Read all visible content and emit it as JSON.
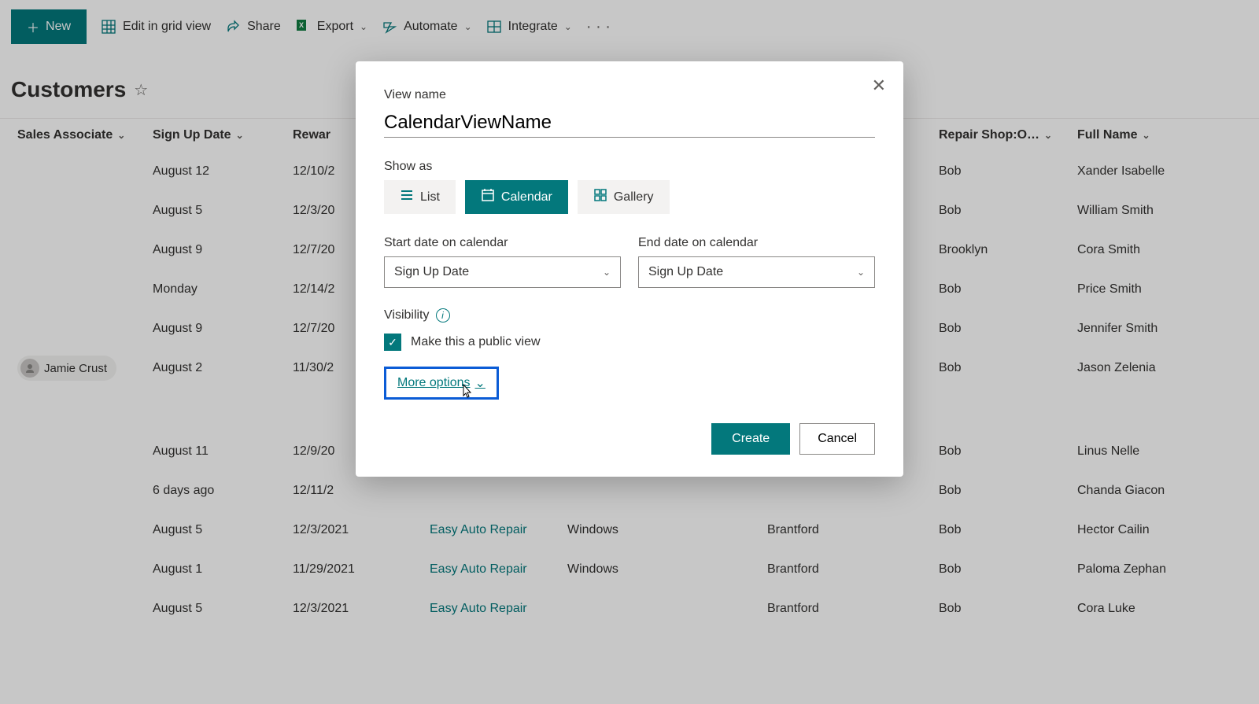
{
  "toolbar": {
    "new_label": "New",
    "edit_grid_label": "Edit in grid view",
    "share_label": "Share",
    "export_label": "Export",
    "automate_label": "Automate",
    "integrate_label": "Integrate"
  },
  "list": {
    "title": "Customers"
  },
  "columns": {
    "assoc": "Sales Associate",
    "signup": "Sign Up Date",
    "reward": "Rewar",
    "owner": "Repair Shop:O…",
    "full": "Full Name"
  },
  "rows": [
    {
      "assoc": "",
      "signup": "August 12",
      "reward": "12/10/2",
      "shop": "",
      "os": "",
      "city": "",
      "owner": "Bob",
      "full": "Xander Isabelle"
    },
    {
      "assoc": "",
      "signup": "August 5",
      "reward": "12/3/20",
      "shop": "",
      "os": "",
      "city": "",
      "owner": "Bob",
      "full": "William Smith"
    },
    {
      "assoc": "",
      "signup": "August 9",
      "reward": "12/7/20",
      "shop": "",
      "os": "",
      "city": "",
      "owner": "Brooklyn",
      "full": "Cora Smith"
    },
    {
      "assoc": "",
      "signup": "Monday",
      "reward": "12/14/2",
      "shop": "",
      "os": "",
      "city": "",
      "owner": "Bob",
      "full": "Price Smith"
    },
    {
      "assoc": "",
      "signup": "August 9",
      "reward": "12/7/20",
      "shop": "",
      "os": "",
      "city": "",
      "owner": "Bob",
      "full": "Jennifer Smith"
    },
    {
      "assoc": "Jamie Crust",
      "signup": "August 2",
      "reward": "11/30/2",
      "shop": "",
      "os": "",
      "city": "",
      "owner": "Bob",
      "full": "Jason Zelenia"
    },
    {
      "assoc": "",
      "signup": "August 11",
      "reward": "12/9/20",
      "shop": "",
      "os": "",
      "city": "",
      "owner": "Bob",
      "full": "Linus Nelle"
    },
    {
      "assoc": "",
      "signup": "6 days ago",
      "reward": "12/11/2",
      "shop": "",
      "os": "",
      "city": "",
      "owner": "Bob",
      "full": "Chanda Giacon"
    },
    {
      "assoc": "",
      "signup": "August 5",
      "reward": "12/3/2021",
      "shop": "Easy Auto Repair",
      "os": "Windows",
      "city": "Brantford",
      "owner": "Bob",
      "full": "Hector Cailin"
    },
    {
      "assoc": "",
      "signup": "August 1",
      "reward": "11/29/2021",
      "shop": "Easy Auto Repair",
      "os": "Windows",
      "city": "Brantford",
      "owner": "Bob",
      "full": "Paloma Zephan"
    },
    {
      "assoc": "",
      "signup": "August 5",
      "reward": "12/3/2021",
      "shop": "Easy Auto Repair",
      "os": "",
      "city": "Brantford",
      "owner": "Bob",
      "full": "Cora Luke"
    }
  ],
  "dialog": {
    "view_name_label": "View name",
    "view_name_value": "CalendarViewName",
    "show_as_label": "Show as",
    "list_label": "List",
    "calendar_label": "Calendar",
    "gallery_label": "Gallery",
    "start_date_label": "Start date on calendar",
    "start_date_value": "Sign Up Date",
    "end_date_label": "End date on calendar",
    "end_date_value": "Sign Up Date",
    "visibility_label": "Visibility",
    "public_label": "Make this a public view",
    "more_options_label": "More options",
    "create_label": "Create",
    "cancel_label": "Cancel"
  }
}
